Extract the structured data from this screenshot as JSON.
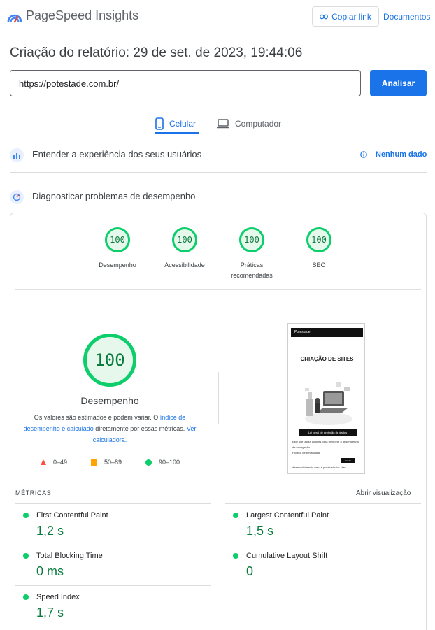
{
  "header": {
    "brand": "PageSpeed Insights",
    "copy_link": "Copiar link",
    "docs": "Documentos"
  },
  "report": {
    "title": "Criação do relatório: 29 de set. de 2023, 19:44:06"
  },
  "search": {
    "url": "https://potestade.com.br/",
    "analyze": "Analisar"
  },
  "tabs": {
    "mobile": "Celular",
    "desktop": "Computador"
  },
  "sections": {
    "experience": "Entender a experiência dos seus usuários",
    "no_data": "Nenhum dado",
    "diagnose": "Diagnosticar problemas de desempenho"
  },
  "scores": [
    {
      "value": "100",
      "label": "Desempenho"
    },
    {
      "value": "100",
      "label": "Acessibilidade"
    },
    {
      "value": "100",
      "label": "Práticas recomendadas"
    },
    {
      "value": "100",
      "label": "SEO"
    }
  ],
  "performance": {
    "score": "100",
    "label": "Desempenho",
    "desc_1": "Os valores são estimados e podem variar. O ",
    "desc_link": "índice de desempenho é calculado",
    "desc_2": " diretamente por essas métricas. ",
    "calc_link": "Ver calculadora."
  },
  "legend": {
    "fail": "0–49",
    "average": "50–89",
    "pass": "90–100"
  },
  "phone": {
    "brand": "Potestade",
    "heading": "CRIAÇÃO DE SITES",
    "banner": "Lei geral de proteção de dados",
    "notice": "Este site utiliza cookies para melhorar o desempenho de navegação.",
    "policy": "Política de privacidade",
    "button": "Aceito",
    "footer": "desenvolvimento web, é possível criar sites"
  },
  "metrics": {
    "heading": "MÉTRICAS",
    "open_view": "Abrir visualização",
    "items": [
      {
        "name": "First Contentful Paint",
        "value": "1,2 s"
      },
      {
        "name": "Largest Contentful Paint",
        "value": "1,5 s"
      },
      {
        "name": "Total Blocking Time",
        "value": "0 ms"
      },
      {
        "name": "Cumulative Layout Shift",
        "value": "0"
      },
      {
        "name": "Speed Index",
        "value": "1,7 s"
      }
    ]
  },
  "colors": {
    "accent": "#1a73e8",
    "pass": "#0cce6b",
    "average": "#ffa400",
    "fail": "#ff4e42"
  }
}
